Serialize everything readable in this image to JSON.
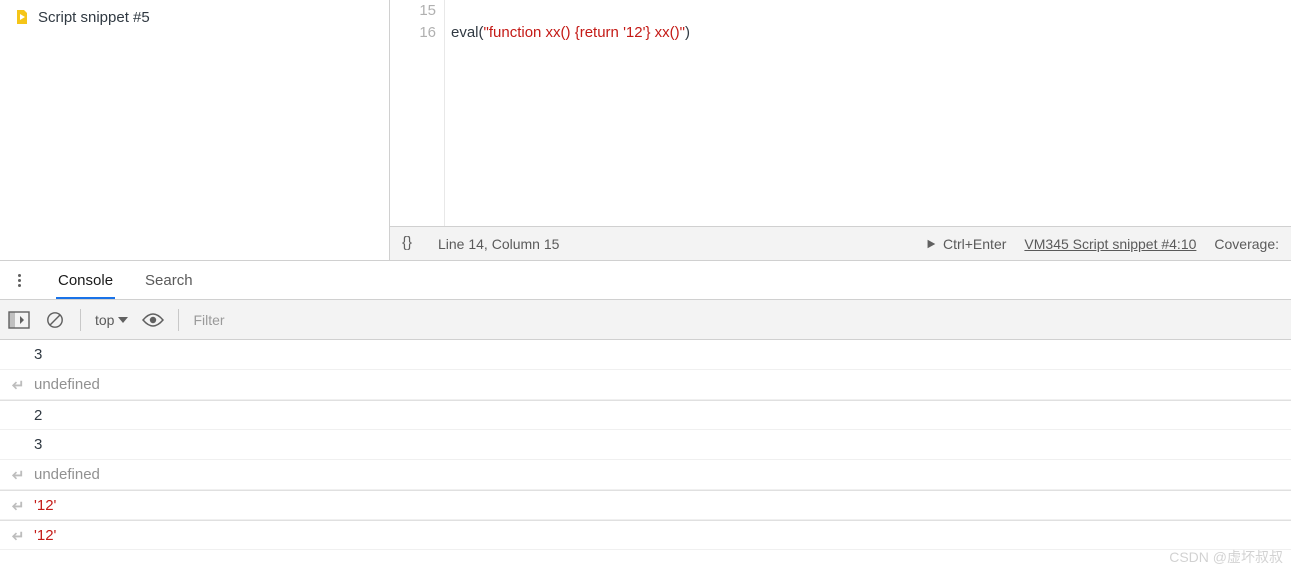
{
  "sidebar": {
    "file_label": "Script snippet #5"
  },
  "editor": {
    "lines": [
      {
        "num": "15",
        "plain": "",
        "string": "",
        "tail": ""
      },
      {
        "num": "16",
        "plain": "eval(",
        "string": "\"function xx() {return '12'} xx()\"",
        "tail": ")"
      }
    ]
  },
  "statusbar": {
    "cursor": "Line 14, Column 15",
    "run_hint": "Ctrl+Enter",
    "source_link": "VM345 Script snippet #4:10",
    "coverage": "Coverage:"
  },
  "tabs": {
    "items": [
      "Console",
      "Search"
    ],
    "active": 0
  },
  "toolbar": {
    "context": "top",
    "filter_placeholder": "Filter"
  },
  "console": {
    "rows": [
      {
        "type": "log",
        "text": "3",
        "cls": "",
        "sep": false
      },
      {
        "type": "return",
        "text": "undefined",
        "cls": "val-undef",
        "sep": false
      },
      {
        "type": "log",
        "text": "2",
        "cls": "",
        "sep": true
      },
      {
        "type": "log",
        "text": "3",
        "cls": "",
        "sep": false
      },
      {
        "type": "return",
        "text": "undefined",
        "cls": "val-undef",
        "sep": false
      },
      {
        "type": "return",
        "text": "'12'",
        "cls": "val-str",
        "sep": true
      },
      {
        "type": "return",
        "text": "'12'",
        "cls": "val-str",
        "sep": true
      }
    ]
  },
  "watermark": "CSDN @虚坏叔叔"
}
